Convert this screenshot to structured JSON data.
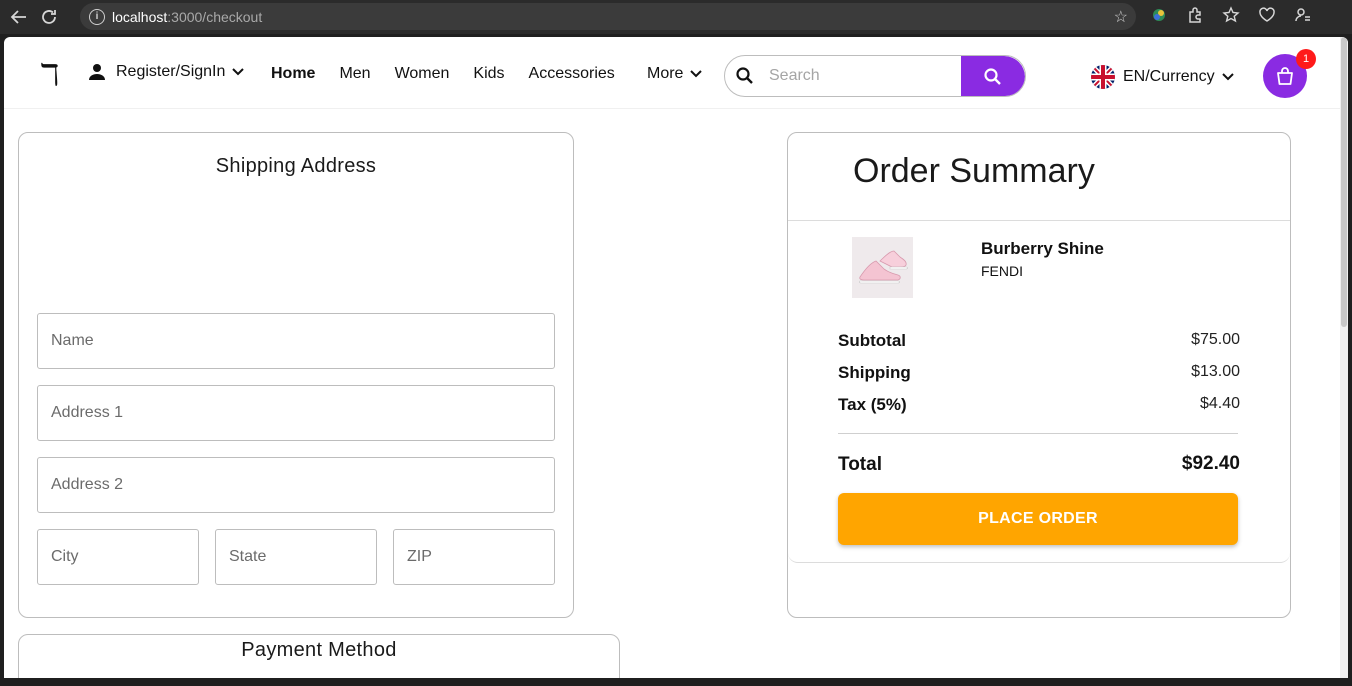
{
  "browser": {
    "url_host": "localhost",
    "url_rest": ":3000/checkout"
  },
  "header": {
    "logo": "ℸ",
    "account_label": "Register/SignIn",
    "nav": {
      "home": "Home",
      "men": "Men",
      "women": "Women",
      "kids": "Kids",
      "accessories": "Accessories",
      "more": "More"
    },
    "search_placeholder": "Search",
    "language_label": "EN/Currency",
    "cart_count": "1"
  },
  "shipping": {
    "title": "Shipping Address",
    "name_placeholder": "Name",
    "address1_placeholder": "Address 1",
    "address2_placeholder": "Address 2",
    "city_placeholder": "City",
    "state_placeholder": "State",
    "zip_placeholder": "ZIP"
  },
  "payment": {
    "title": "Payment Method"
  },
  "order": {
    "title": "Order Summary",
    "product_name": "Burberry Shine",
    "product_brand": "FENDI",
    "subtotal_label": "Subtotal",
    "subtotal_value": "$75.00",
    "shipping_label": "Shipping",
    "shipping_value": "$13.00",
    "tax_label": "Tax (5%)",
    "tax_value": "$4.40",
    "total_label": "Total",
    "total_value": "$92.40",
    "place_order_label": "PLACE ORDER"
  },
  "colors": {
    "accent": "#8a2be2",
    "order_button": "#ffa500",
    "badge": "#ff1a1a"
  }
}
